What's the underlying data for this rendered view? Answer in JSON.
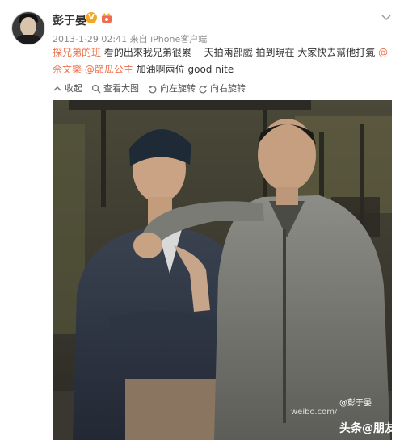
{
  "post": {
    "user_name": "彭于晏",
    "verified_badge": "V",
    "timestamp": "2013-1-29 02:41",
    "source": "来自 iPhone客户端",
    "hashtag": "探兄弟的班",
    "body_1": " 看的出來我兄弟很累 一天拍兩部戲 拍到現在 大家快去幫他打氣 ",
    "mention_1": "@佘文樂",
    "mention_2": "@節瓜公主",
    "body_2": " 加油啊兩位 good nite"
  },
  "toolbar": {
    "collect": "收起",
    "view_large": "查看大图",
    "rotate_left": "向左旋转",
    "rotate_right": "向右旋转"
  },
  "watermarks": {
    "user_tag": "@彭于晏",
    "site": "weibo.com/",
    "toutiao": "头条@朋友"
  },
  "colors": {
    "link": "#eb7350",
    "meta": "#8a8a8a",
    "verified": "#f5a623"
  }
}
